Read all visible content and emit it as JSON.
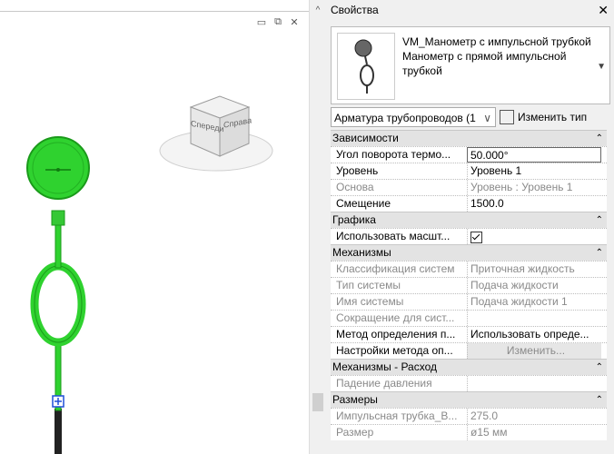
{
  "view": {
    "window_controls": [
      "▭",
      "⧉",
      "✕"
    ],
    "scroll_up": "^",
    "viewcube": {
      "front": "Спереди",
      "right": "Справа"
    }
  },
  "properties": {
    "title": "Свойства",
    "close": "✕",
    "type_selector": {
      "family": "VM_Манометр с импульсной трубкой",
      "type": "Манометр с прямой импульсной трубкой",
      "arrow": "▼"
    },
    "filter": {
      "value": "Арматура трубопроводов (1",
      "chevron": "∨"
    },
    "edit_type_label": "Изменить тип",
    "sections": [
      {
        "title": "Зависимости",
        "rows": [
          {
            "key": "Угол поворота термо...",
            "value": "50.000°",
            "state": "edit"
          },
          {
            "key": "Уровень",
            "value": "Уровень 1",
            "state": "normal"
          },
          {
            "key": "Основа",
            "value": "Уровень : Уровень 1",
            "state": "gray"
          },
          {
            "key": "Смещение",
            "value": "1500.0",
            "state": "normal"
          }
        ]
      },
      {
        "title": "Графика",
        "rows": [
          {
            "key": "Использовать масшт...",
            "value": "",
            "state": "checkbox"
          }
        ]
      },
      {
        "title": "Механизмы",
        "rows": [
          {
            "key": "Классификация систем",
            "value": "Приточная жидкость",
            "state": "gray"
          },
          {
            "key": "Тип системы",
            "value": "Подача жидкости",
            "state": "gray"
          },
          {
            "key": "Имя системы",
            "value": "Подача жидкости 1",
            "state": "gray"
          },
          {
            "key": "Сокращение для сист...",
            "value": "",
            "state": "gray"
          },
          {
            "key": "Метод определения п...",
            "value": "Использовать опреде...",
            "state": "normal"
          },
          {
            "key": "Настройки метода оп...",
            "value": "Изменить...",
            "state": "button"
          }
        ]
      },
      {
        "title": "Механизмы - Расход",
        "rows": [
          {
            "key": "Падение давления",
            "value": "",
            "state": "gray"
          }
        ]
      },
      {
        "title": "Размеры",
        "rows": [
          {
            "key": "Импульсная трубка_В...",
            "value": "275.0",
            "state": "gray"
          },
          {
            "key": "Размер",
            "value": "ø15 мм",
            "state": "gray"
          }
        ]
      }
    ],
    "collapse_glyph": "⌃"
  }
}
